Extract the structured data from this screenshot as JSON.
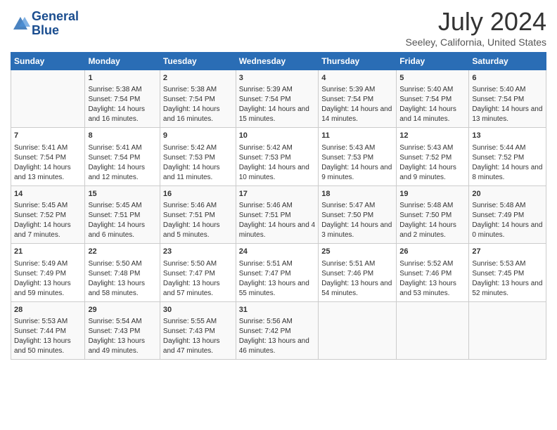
{
  "header": {
    "logo_line1": "General",
    "logo_line2": "Blue",
    "title": "July 2024",
    "subtitle": "Seeley, California, United States"
  },
  "weekdays": [
    "Sunday",
    "Monday",
    "Tuesday",
    "Wednesday",
    "Thursday",
    "Friday",
    "Saturday"
  ],
  "weeks": [
    [
      {
        "day": "",
        "content": ""
      },
      {
        "day": "1",
        "content": "Sunrise: 5:38 AM\nSunset: 7:54 PM\nDaylight: 14 hours and 16 minutes."
      },
      {
        "day": "2",
        "content": "Sunrise: 5:38 AM\nSunset: 7:54 PM\nDaylight: 14 hours and 16 minutes."
      },
      {
        "day": "3",
        "content": "Sunrise: 5:39 AM\nSunset: 7:54 PM\nDaylight: 14 hours and 15 minutes."
      },
      {
        "day": "4",
        "content": "Sunrise: 5:39 AM\nSunset: 7:54 PM\nDaylight: 14 hours and 14 minutes."
      },
      {
        "day": "5",
        "content": "Sunrise: 5:40 AM\nSunset: 7:54 PM\nDaylight: 14 hours and 14 minutes."
      },
      {
        "day": "6",
        "content": "Sunrise: 5:40 AM\nSunset: 7:54 PM\nDaylight: 14 hours and 13 minutes."
      }
    ],
    [
      {
        "day": "7",
        "content": "Sunrise: 5:41 AM\nSunset: 7:54 PM\nDaylight: 14 hours and 13 minutes."
      },
      {
        "day": "8",
        "content": "Sunrise: 5:41 AM\nSunset: 7:54 PM\nDaylight: 14 hours and 12 minutes."
      },
      {
        "day": "9",
        "content": "Sunrise: 5:42 AM\nSunset: 7:53 PM\nDaylight: 14 hours and 11 minutes."
      },
      {
        "day": "10",
        "content": "Sunrise: 5:42 AM\nSunset: 7:53 PM\nDaylight: 14 hours and 10 minutes."
      },
      {
        "day": "11",
        "content": "Sunrise: 5:43 AM\nSunset: 7:53 PM\nDaylight: 14 hours and 9 minutes."
      },
      {
        "day": "12",
        "content": "Sunrise: 5:43 AM\nSunset: 7:52 PM\nDaylight: 14 hours and 9 minutes."
      },
      {
        "day": "13",
        "content": "Sunrise: 5:44 AM\nSunset: 7:52 PM\nDaylight: 14 hours and 8 minutes."
      }
    ],
    [
      {
        "day": "14",
        "content": "Sunrise: 5:45 AM\nSunset: 7:52 PM\nDaylight: 14 hours and 7 minutes."
      },
      {
        "day": "15",
        "content": "Sunrise: 5:45 AM\nSunset: 7:51 PM\nDaylight: 14 hours and 6 minutes."
      },
      {
        "day": "16",
        "content": "Sunrise: 5:46 AM\nSunset: 7:51 PM\nDaylight: 14 hours and 5 minutes."
      },
      {
        "day": "17",
        "content": "Sunrise: 5:46 AM\nSunset: 7:51 PM\nDaylight: 14 hours and 4 minutes."
      },
      {
        "day": "18",
        "content": "Sunrise: 5:47 AM\nSunset: 7:50 PM\nDaylight: 14 hours and 3 minutes."
      },
      {
        "day": "19",
        "content": "Sunrise: 5:48 AM\nSunset: 7:50 PM\nDaylight: 14 hours and 2 minutes."
      },
      {
        "day": "20",
        "content": "Sunrise: 5:48 AM\nSunset: 7:49 PM\nDaylight: 14 hours and 0 minutes."
      }
    ],
    [
      {
        "day": "21",
        "content": "Sunrise: 5:49 AM\nSunset: 7:49 PM\nDaylight: 13 hours and 59 minutes."
      },
      {
        "day": "22",
        "content": "Sunrise: 5:50 AM\nSunset: 7:48 PM\nDaylight: 13 hours and 58 minutes."
      },
      {
        "day": "23",
        "content": "Sunrise: 5:50 AM\nSunset: 7:47 PM\nDaylight: 13 hours and 57 minutes."
      },
      {
        "day": "24",
        "content": "Sunrise: 5:51 AM\nSunset: 7:47 PM\nDaylight: 13 hours and 55 minutes."
      },
      {
        "day": "25",
        "content": "Sunrise: 5:51 AM\nSunset: 7:46 PM\nDaylight: 13 hours and 54 minutes."
      },
      {
        "day": "26",
        "content": "Sunrise: 5:52 AM\nSunset: 7:46 PM\nDaylight: 13 hours and 53 minutes."
      },
      {
        "day": "27",
        "content": "Sunrise: 5:53 AM\nSunset: 7:45 PM\nDaylight: 13 hours and 52 minutes."
      }
    ],
    [
      {
        "day": "28",
        "content": "Sunrise: 5:53 AM\nSunset: 7:44 PM\nDaylight: 13 hours and 50 minutes."
      },
      {
        "day": "29",
        "content": "Sunrise: 5:54 AM\nSunset: 7:43 PM\nDaylight: 13 hours and 49 minutes."
      },
      {
        "day": "30",
        "content": "Sunrise: 5:55 AM\nSunset: 7:43 PM\nDaylight: 13 hours and 47 minutes."
      },
      {
        "day": "31",
        "content": "Sunrise: 5:56 AM\nSunset: 7:42 PM\nDaylight: 13 hours and 46 minutes."
      },
      {
        "day": "",
        "content": ""
      },
      {
        "day": "",
        "content": ""
      },
      {
        "day": "",
        "content": ""
      }
    ]
  ]
}
